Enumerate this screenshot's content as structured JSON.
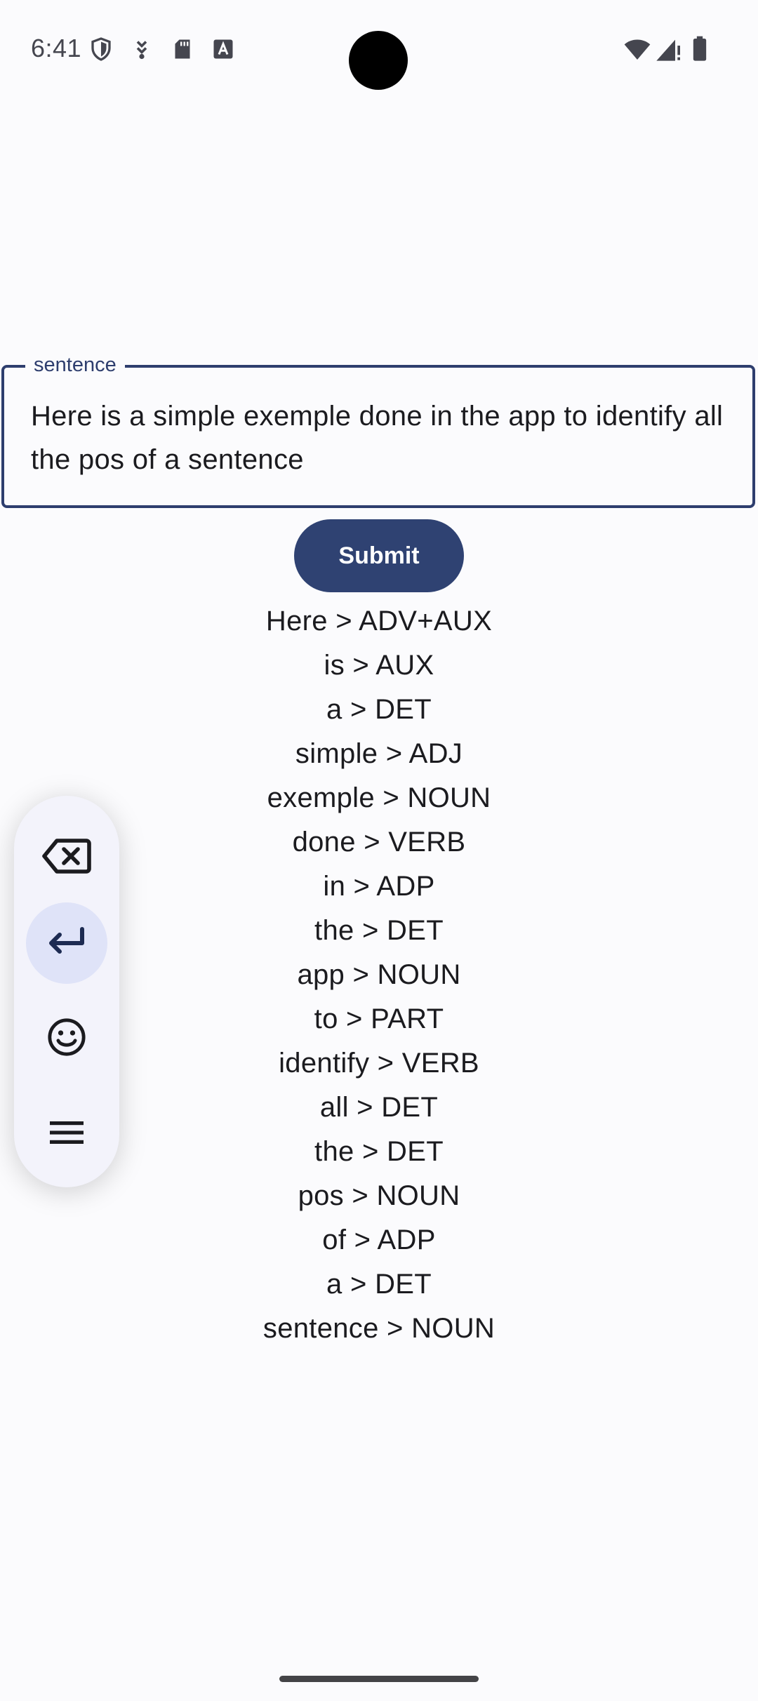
{
  "status_bar": {
    "time": "6:41",
    "left_icons": [
      "shield-icon",
      "usb-debug-icon",
      "sd-card-icon",
      "font-icon"
    ],
    "right_icons": [
      "wifi-icon",
      "cell-signal-icon",
      "battery-icon"
    ]
  },
  "input": {
    "label": "sentence",
    "value": "Here is a simple exemple done in the app to identify all the pos of a sentence"
  },
  "submit": {
    "label": "Submit"
  },
  "results": [
    "Here > ADV+AUX",
    "is > AUX",
    "a > DET",
    "simple > ADJ",
    "exemple > NOUN",
    "done > VERB",
    "in > ADP",
    "the > DET",
    "app > NOUN",
    "to > PART",
    "identify > VERB",
    "all > DET",
    "the > DET",
    "pos > NOUN",
    "of > ADP",
    "a > DET",
    "sentence > NOUN"
  ],
  "keyboard_toolbar": {
    "buttons": [
      "backspace-icon",
      "enter-icon",
      "emoji-icon",
      "menu-icon"
    ],
    "active": "enter-icon"
  },
  "colors": {
    "accent": "#2e3e6e",
    "button": "#2f4272",
    "background": "#fbfbfd",
    "toolbar_active": "#dfe3f8"
  }
}
